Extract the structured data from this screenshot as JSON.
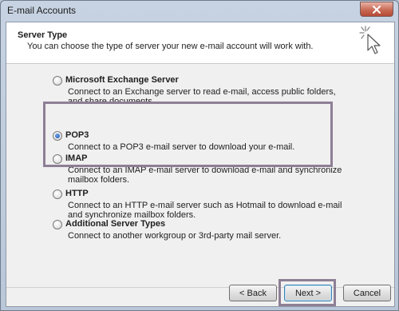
{
  "window": {
    "title": "E-mail Accounts"
  },
  "header": {
    "title": "Server Type",
    "subtitle": "You can choose the type of server your new e-mail account will work with.",
    "icon": "cursor-sparkle-icon"
  },
  "options": [
    {
      "label": "Microsoft Exchange Server",
      "description": "Connect to an Exchange server to read e-mail, access public folders, and share documents.",
      "checked": false
    },
    {
      "label": "POP3",
      "description": "Connect to a POP3 e-mail server to download your e-mail.",
      "checked": true
    },
    {
      "label": "IMAP",
      "description": "Connect to an IMAP e-mail server to download e-mail and synchronize mailbox folders.",
      "checked": false
    },
    {
      "label": "HTTP",
      "description": "Connect to an HTTP e-mail server such as Hotmail to download e-mail and synchronize mailbox folders.",
      "checked": false
    },
    {
      "label": "Additional Server Types",
      "description": "Connect to another workgroup or 3rd-party mail server.",
      "checked": false
    }
  ],
  "buttons": {
    "back": "< Back",
    "next": "Next >",
    "cancel": "Cancel"
  },
  "colors": {
    "highlight_border": "#8e7f95",
    "radio_selected": "#1f57b4"
  }
}
